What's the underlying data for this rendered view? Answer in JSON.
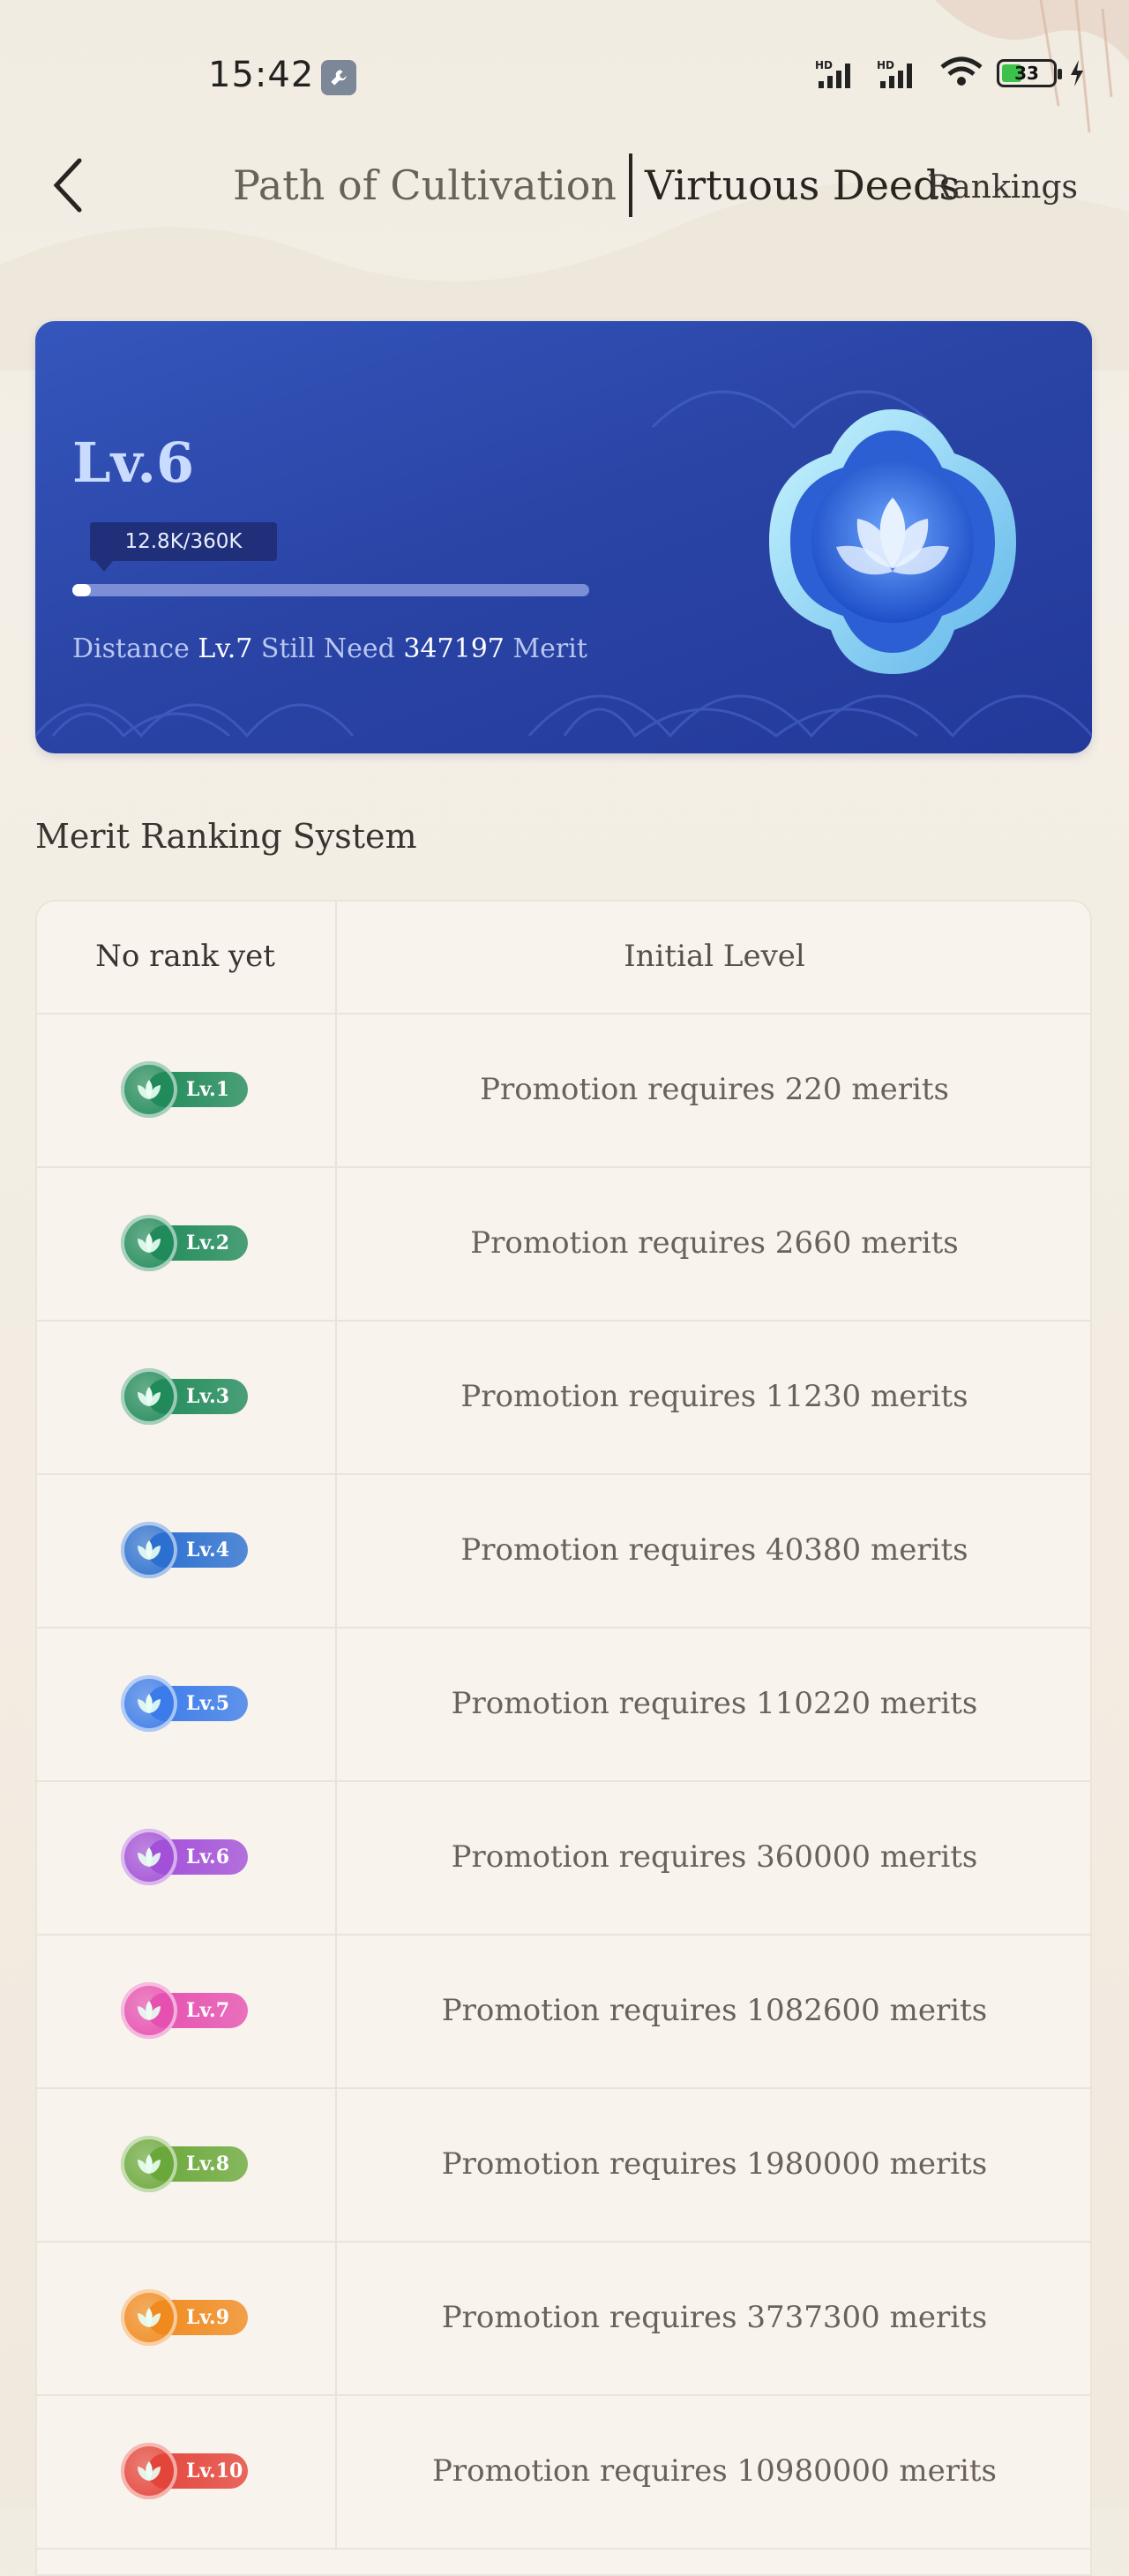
{
  "status_bar": {
    "time": "15:42",
    "battery": "33"
  },
  "nav": {
    "tab_1": "Path of Cultivation",
    "tab_2": "Virtuous Deeds",
    "rankings": "Rankings"
  },
  "hero": {
    "level": "Lv.6",
    "progress_text": "12.8K/360K",
    "progress_fraction": 0.0356,
    "distance_prefix": "Distance",
    "next_level": "Lv.7",
    "still_need": "Still Need",
    "need_value": "347197",
    "unit": "Merit"
  },
  "section_title": "Merit Ranking System",
  "table": {
    "header": {
      "col1": "No rank yet",
      "col2": "Initial Level"
    },
    "rows": [
      {
        "badge": "Lv.1",
        "text": "Promotion requires 220 merits",
        "color": "#1f8a5a"
      },
      {
        "badge": "Lv.2",
        "text": "Promotion requires 2660 merits",
        "color": "#1f8a5a"
      },
      {
        "badge": "Lv.3",
        "text": "Promotion requires 11230 merits",
        "color": "#1f8a5a"
      },
      {
        "badge": "Lv.4",
        "text": "Promotion requires 40380 merits",
        "color": "#2a6fd0"
      },
      {
        "badge": "Lv.5",
        "text": "Promotion requires 110220 merits",
        "color": "#3a7bea"
      },
      {
        "badge": "Lv.6",
        "text": "Promotion requires 360000 merits",
        "color": "#a24fd8"
      },
      {
        "badge": "Lv.7",
        "text": "Promotion requires 1082600 merits",
        "color": "#e64fb0"
      },
      {
        "badge": "Lv.8",
        "text": "Promotion requires 1980000 merits",
        "color": "#6aa83a"
      },
      {
        "badge": "Lv.9",
        "text": "Promotion requires 3737300 merits",
        "color": "#f08a1e"
      },
      {
        "badge": "Lv.10",
        "text": "Promotion requires 10980000 merits",
        "color": "#e4443a"
      }
    ]
  }
}
